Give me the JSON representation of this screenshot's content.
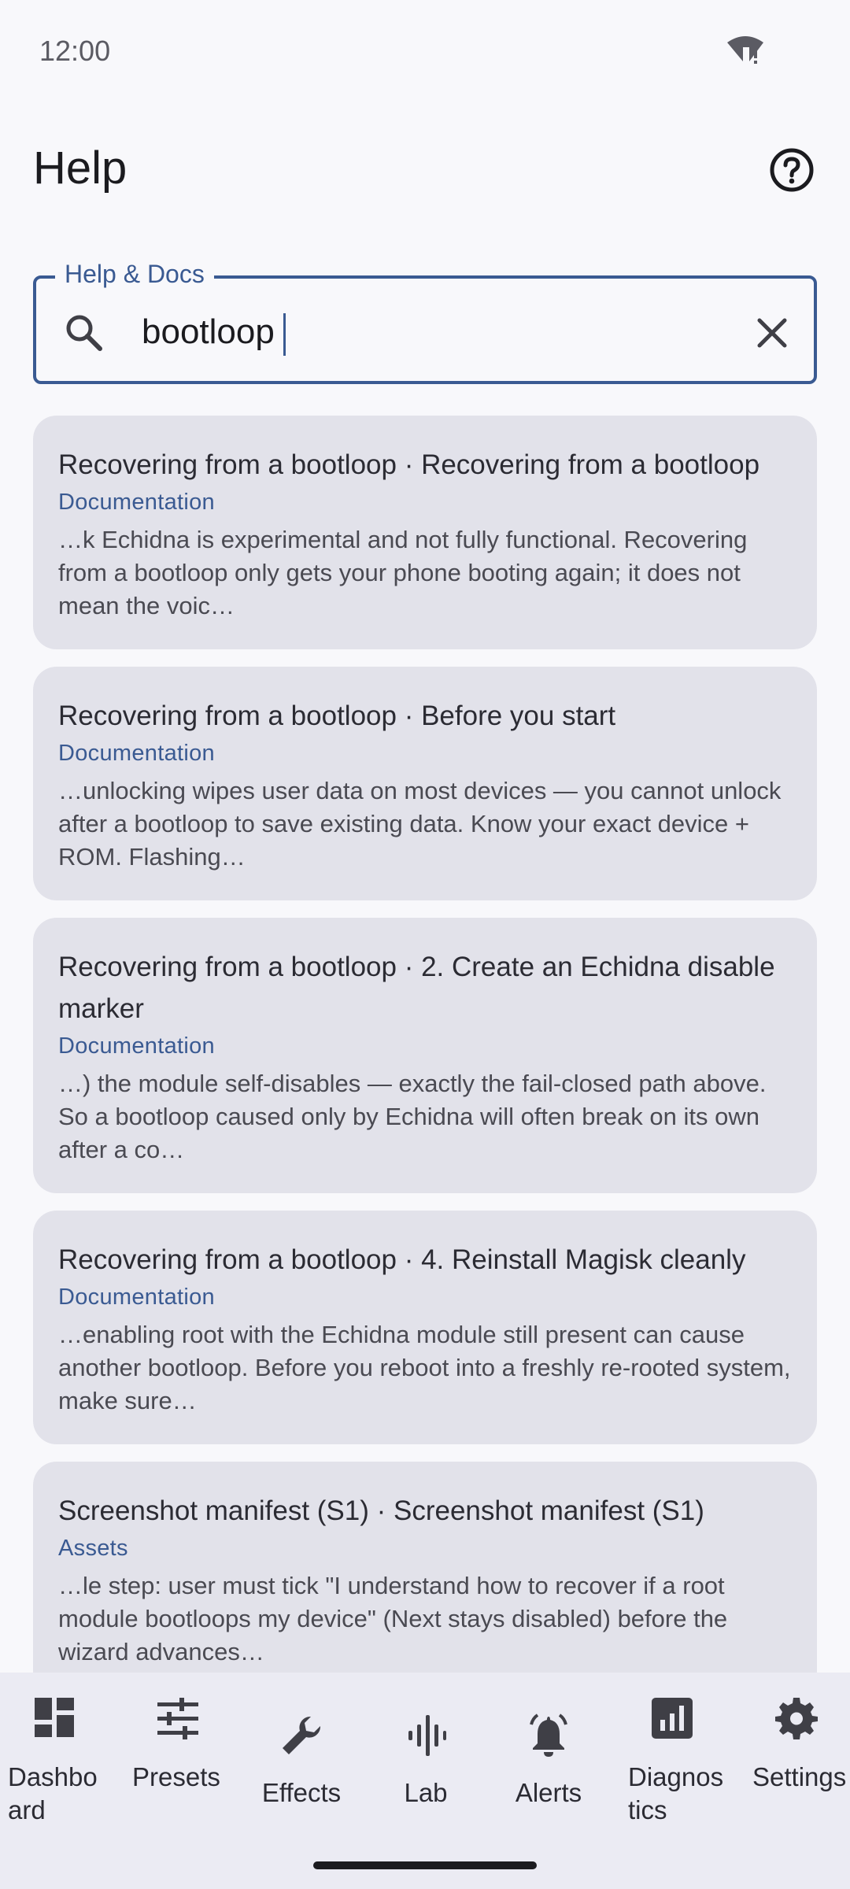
{
  "status_bar": {
    "time": "12:00"
  },
  "app_bar": {
    "title": "Help"
  },
  "search": {
    "label": "Help & Docs",
    "value": "bootloop"
  },
  "results": [
    {
      "title": "Recovering from a bootloop · Recovering from a bootloop",
      "category": "Documentation",
      "snippet": "…k Echidna is experimental and not fully functional. Recovering from a bootloop only gets your phone booting again; it does not mean the voic…"
    },
    {
      "title": "Recovering from a bootloop · Before you start",
      "category": "Documentation",
      "snippet": "…unlocking wipes user data on most devices — you cannot unlock after a bootloop to save existing data. Know your exact device + ROM. Flashing…"
    },
    {
      "title": "Recovering from a bootloop · 2. Create an Echidna disable marker",
      "category": "Documentation",
      "snippet": "…) the module self-disables — exactly the fail-closed path above. So a bootloop caused only by Echidna will often break on its own after a co…"
    },
    {
      "title": "Recovering from a bootloop · 4. Reinstall Magisk cleanly",
      "category": "Documentation",
      "snippet": "…enabling root with the Echidna module still present can cause another bootloop. Before you reboot into a freshly re-rooted system, make sure…"
    },
    {
      "title": "Screenshot manifest (S1) · Screenshot manifest (S1)",
      "category": "Assets",
      "snippet": "…le step: user must tick \"I understand how to recover if a root module bootloops my device\" (Next stays disabled) before the wizard advances…"
    }
  ],
  "bottom_nav": [
    {
      "label": "Dashboard",
      "icon": "dashboard-icon"
    },
    {
      "label": "Presets",
      "icon": "tune-icon"
    },
    {
      "label": "Effects",
      "icon": "wrench-icon"
    },
    {
      "label": "Lab",
      "icon": "waveform-icon"
    },
    {
      "label": "Alerts",
      "icon": "bell-icon"
    },
    {
      "label": "Diagnostics",
      "icon": "chart-icon"
    },
    {
      "label": "Settings",
      "icon": "gear-icon"
    }
  ],
  "colors": {
    "accent": "#3a5a92",
    "card": "#e2e2ea",
    "background": "#f8f8fb",
    "nav": "#ebebf3"
  }
}
